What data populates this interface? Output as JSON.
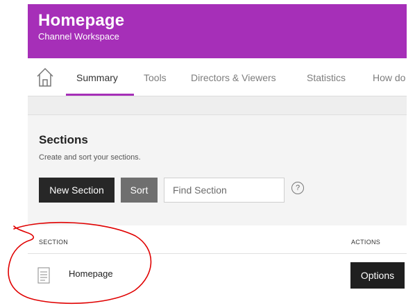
{
  "colors": {
    "brand": "#a62fb8",
    "annotation": "#e00000"
  },
  "header": {
    "title": "Homepage",
    "subtitle": "Channel Workspace"
  },
  "nav": {
    "home_icon": "home-icon",
    "tabs": [
      {
        "label": "Summary",
        "active": true
      },
      {
        "label": "Tools"
      },
      {
        "label": "Directors & Viewers"
      },
      {
        "label": "Statistics"
      },
      {
        "label": "How do"
      }
    ]
  },
  "sections": {
    "title": "Sections",
    "description": "Create and sort your sections.",
    "new_button": "New Section",
    "sort_button": "Sort",
    "search_placeholder": "Find Section",
    "help_icon": "help-circle-icon",
    "help_glyph": "?"
  },
  "table": {
    "columns": {
      "section": "SECTION",
      "actions": "ACTIONS"
    },
    "rows": [
      {
        "name": "Homepage",
        "icon": "document-icon",
        "action": "Options"
      }
    ]
  }
}
